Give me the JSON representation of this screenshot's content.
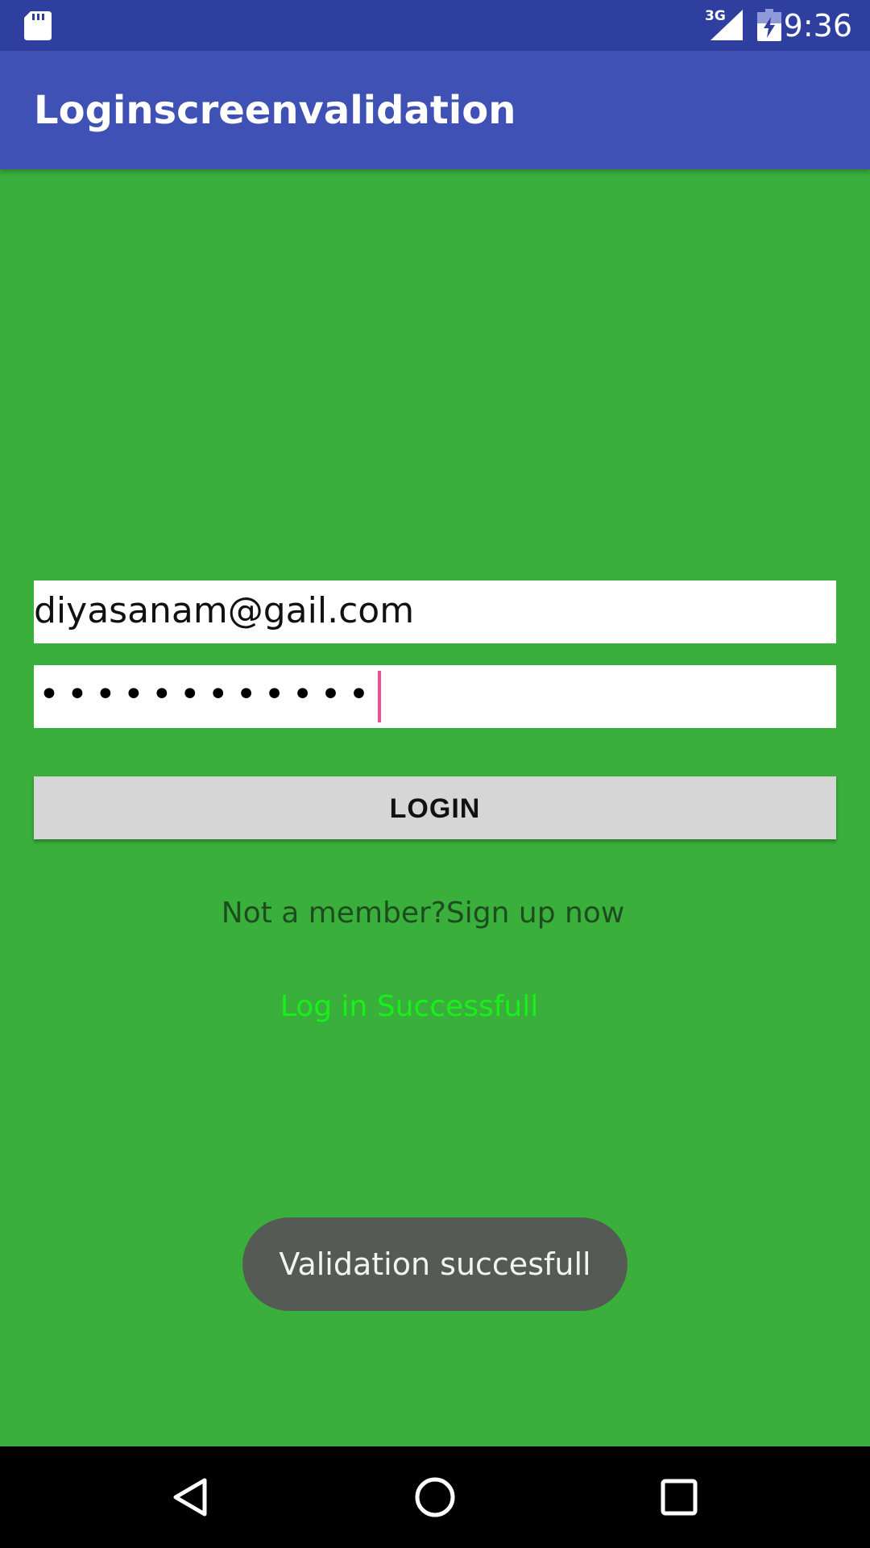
{
  "status_bar": {
    "time": "9:36",
    "network_type": "3G",
    "icons": [
      "sd-card-icon",
      "signal-icon",
      "battery-charging-icon"
    ]
  },
  "app_bar": {
    "title": "Loginscreenvalidation"
  },
  "form": {
    "email_value": "diyasanam@gail.com",
    "password_masked": "••••••••••••",
    "login_label": "LOGIN",
    "signup_text": "Not a member?Sign up now",
    "success_text": "Log in Successfull"
  },
  "toast": {
    "text": "Validation succesfull"
  },
  "nav_bar": {
    "icons": [
      "back-icon",
      "home-icon",
      "recents-icon"
    ]
  },
  "colors": {
    "status_bar": "#2f3fa0",
    "app_bar": "#3f51b5",
    "background": "#3aaf3b",
    "success_text": "#19f019",
    "cursor": "#ef4f8f",
    "toast": "#555b54"
  }
}
